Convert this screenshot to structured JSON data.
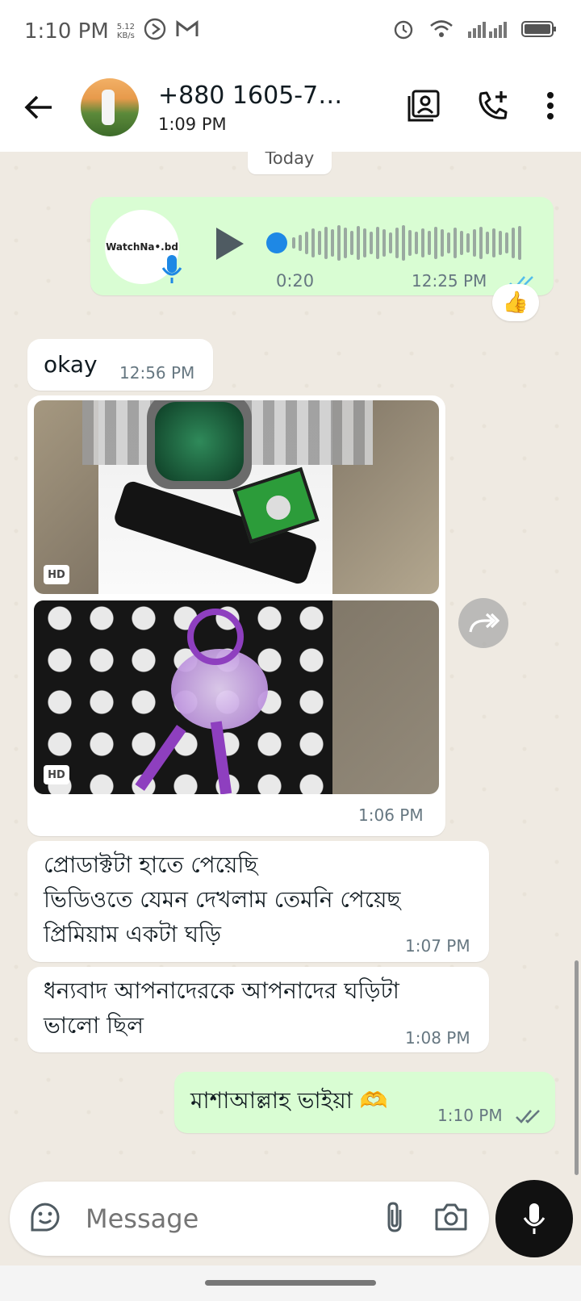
{
  "status": {
    "time": "1:10 PM",
    "speed_value": "5.12",
    "speed_unit": "KB/s"
  },
  "header": {
    "name": "+880 1605-78...",
    "subtitle": "1:09 PM"
  },
  "chat": {
    "date_label": "Today",
    "voice": {
      "avatar_text": "WatchNa•.bd",
      "duration": "0:20",
      "time": "12:25 PM",
      "reaction": "👍",
      "progress": 0.0
    },
    "msg_okay": {
      "text": "okay",
      "time": "12:56 PM"
    },
    "photos": {
      "badge1": "HD",
      "badge2": "HD",
      "time": "1:06 PM"
    },
    "msg1": {
      "lines": [
        "প্রোডাক্টটা হাতে পেয়েছি",
        "ভিডিওতে যেমন দেখলাম তেমনি পেয়েছ",
        "প্রিমিয়াম একটা ঘড়ি"
      ],
      "time": "1:07 PM"
    },
    "msg2": {
      "lines": [
        "ধন্যবাদ আপনাদেরকে আপনাদের ঘড়িটা",
        "ভালো ছিল"
      ],
      "time": "1:08 PM"
    },
    "msg3": {
      "text": "মাশাআল্লাহ ভাইয়া 🫶",
      "time": "1:10 PM"
    }
  },
  "input": {
    "placeholder": "Message"
  },
  "colors": {
    "outgoing": "#d9fdd3",
    "incoming": "#ffffff",
    "tick_blue": "#53bdeb",
    "background": "#efeae2"
  }
}
